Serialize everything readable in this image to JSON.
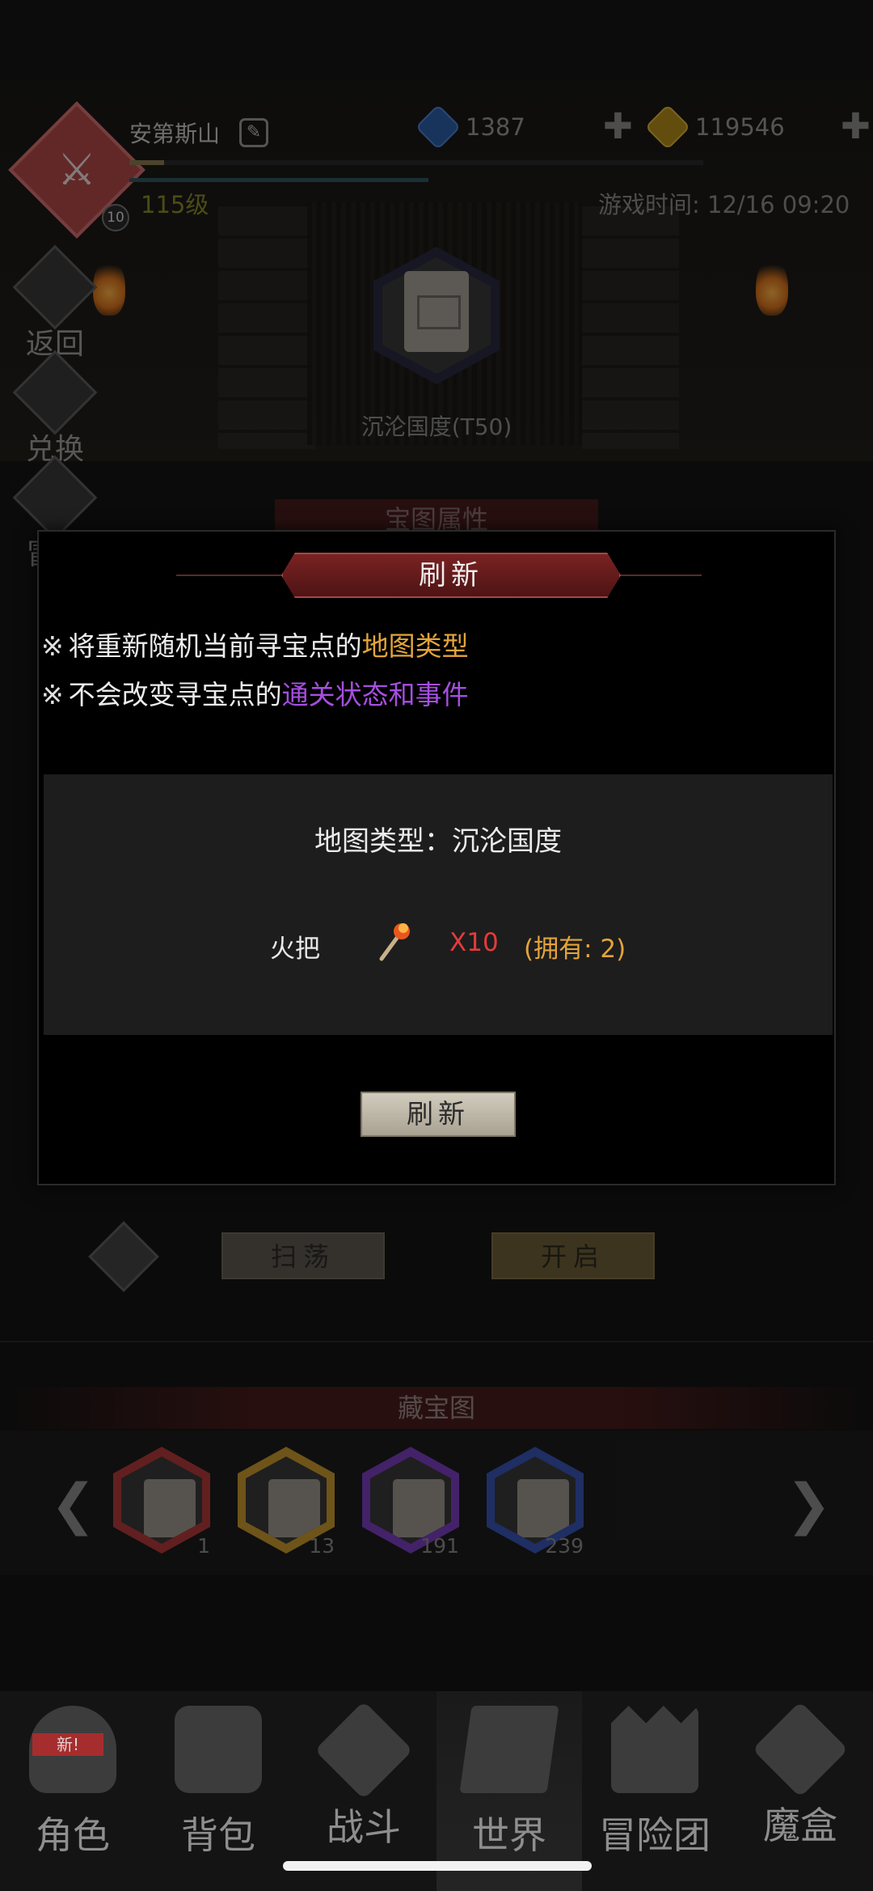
{
  "player": {
    "name": "安第斯山",
    "level": "115级",
    "badge_level": "10"
  },
  "currencies": {
    "diamonds": "1387",
    "gold": "119546",
    "plus_label": "✚"
  },
  "game_time": "游戏时间: 12/16 09:20",
  "side_menu": {
    "back": "返回",
    "exchange": "兑换",
    "adventure": "冒险"
  },
  "map": {
    "name": "沉沦国度(T50)",
    "section_header": "宝图属性"
  },
  "dialog": {
    "title": "刷新",
    "note_mark": "※",
    "note1_prefix": "将重新随机当前寻宝点的",
    "note1_highlight": "地图类型",
    "note2_prefix": "不会改变寻宝点的",
    "note2_highlight": "通关状态和事件",
    "map_type": "地图类型：沉沦国度",
    "cost_label": "火把",
    "cost_qty": "X10",
    "cost_owned": "(拥有: 2)",
    "refresh_button": "刷新"
  },
  "actions": {
    "sweep": "扫荡",
    "open": "开启"
  },
  "treasure_maps": {
    "title": "藏宝图",
    "prev": "❮",
    "next": "❯",
    "items": [
      {
        "count": "1",
        "color": "#b23a3a"
      },
      {
        "count": "13",
        "color": "#c99a2e"
      },
      {
        "count": "191",
        "color": "#7a3fc0"
      },
      {
        "count": "239",
        "color": "#3a55b5"
      }
    ]
  },
  "bottom_nav": {
    "new_badge": "新!",
    "items": [
      "角色",
      "背包",
      "战斗",
      "世界",
      "冒险团",
      "魔盒"
    ]
  }
}
